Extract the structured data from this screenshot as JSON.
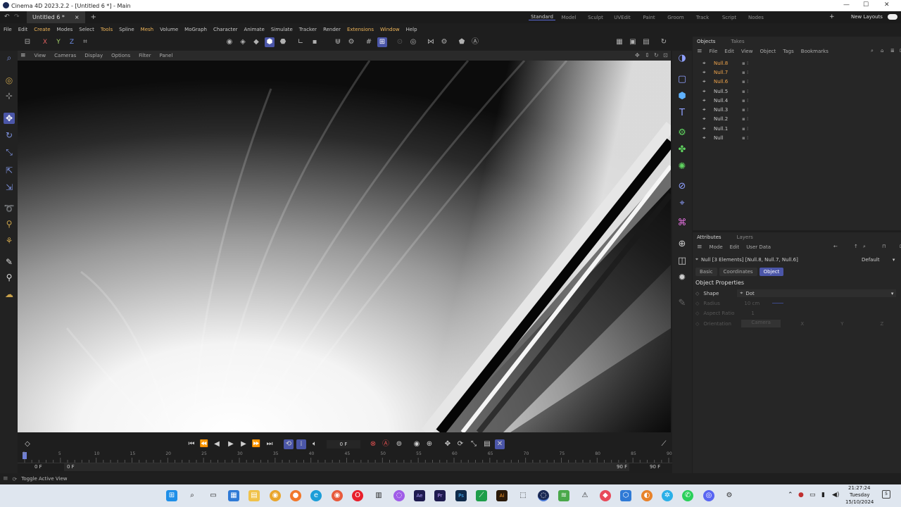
{
  "window": {
    "title": "Cinema 4D 2023.2.2 - [Untitled 6 *] - Main",
    "min": "—",
    "max": "☐",
    "close": "✕"
  },
  "tabs": {
    "doc": "Untitled 6 *",
    "close": "×",
    "add": "+"
  },
  "layouts": [
    "Standard",
    "Model",
    "Sculpt",
    "UVEdit",
    "Paint",
    "Groom",
    "Track",
    "Script",
    "Nodes"
  ],
  "layout_extra": {
    "add": "+",
    "new_layouts": "New Layouts"
  },
  "menu": [
    "File",
    "Edit",
    "Create",
    "Modes",
    "Select",
    "Tools",
    "Spline",
    "Mesh",
    "Volume",
    "MoGraph",
    "Character",
    "Animate",
    "Simulate",
    "Tracker",
    "Render",
    "Extensions",
    "Window",
    "Help"
  ],
  "viewport_menu": [
    "View",
    "Cameras",
    "Display",
    "Options",
    "Filter",
    "Panel"
  ],
  "axis_buttons": [
    "X",
    "Y",
    "Z"
  ],
  "objects_panel": {
    "tabs": [
      "Objects",
      "Takes"
    ],
    "menu": [
      "File",
      "Edit",
      "View",
      "Object",
      "Tags",
      "Bookmarks"
    ],
    "items": [
      {
        "name": "Null.8",
        "selected": true
      },
      {
        "name": "Null.7",
        "selected": true
      },
      {
        "name": "Null.6",
        "selected": true
      },
      {
        "name": "Null.5",
        "selected": false
      },
      {
        "name": "Null.4",
        "selected": false
      },
      {
        "name": "Null.3",
        "selected": false
      },
      {
        "name": "Null.2",
        "selected": false
      },
      {
        "name": "Null.1",
        "selected": false
      },
      {
        "name": "Null",
        "selected": false
      }
    ]
  },
  "attributes_panel": {
    "tabs": [
      "Attributes",
      "Layers"
    ],
    "menu": [
      "Mode",
      "Edit",
      "User Data"
    ],
    "selection": "Null [3 Elements] [Null.8, Null.7, Null.6]",
    "preset": "Default",
    "sub_tabs": [
      "Basic",
      "Coordinates",
      "Object"
    ],
    "section": "Object Properties",
    "shape_label": "Shape",
    "shape_value": "Dot",
    "radius_label": "Radius",
    "radius_value": "10 cm",
    "aspect_label": "Aspect Ratio",
    "aspect_value": "1",
    "orientation_label": "Orientation",
    "orientation_value": "Camera",
    "orientation_axes": [
      "X",
      "Y",
      "Z"
    ]
  },
  "timeline": {
    "current_frame": "0 F",
    "ticks": [
      "0",
      "5",
      "10",
      "15",
      "20",
      "25",
      "30",
      "35",
      "40",
      "45",
      "50",
      "55",
      "60",
      "65",
      "70",
      "75",
      "80",
      "85",
      "90"
    ],
    "start": "0 F",
    "start2": "0 F",
    "end": "90 F",
    "end2": "90 F"
  },
  "status": {
    "text": "Toggle Active View"
  },
  "clock": {
    "time": "21:27:24",
    "day": "Tuesday",
    "date": "15/10/2024"
  }
}
